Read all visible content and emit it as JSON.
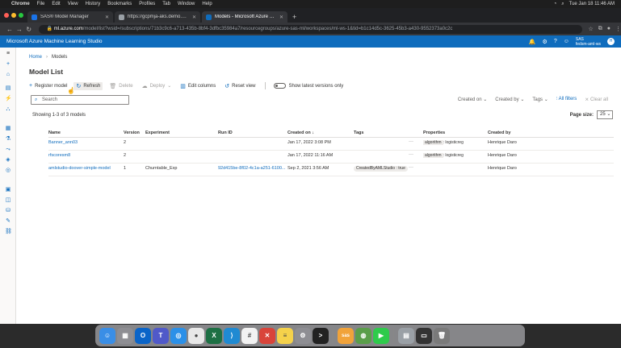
{
  "menubar": {
    "app": "Chrome",
    "items": [
      "File",
      "Edit",
      "View",
      "History",
      "Bookmarks",
      "Profiles",
      "Tab",
      "Window",
      "Help"
    ],
    "clock": "Tue Jan 18 11:46 AM"
  },
  "tabs": [
    {
      "title": "SAS® Model Manager",
      "color": "#1a73e8"
    },
    {
      "title": "https://gcpmja-aks.demo.sas.com",
      "color": "#9aa0a6"
    },
    {
      "title": "Models - Microsoft Azure Machi...",
      "color": "#0f6cbd",
      "active": true
    }
  ],
  "address": {
    "host": "ml.azure.com",
    "path": "/model/list?wsid=/subscriptions/71b3c9c6-a713-435b-8bf4-3dfbc35984a7/resourcegroups/azure-sas-ml/workspaces/ml-ws-1&tid=b1c14d5c-3625-45b3-a430-9552373a0c2c"
  },
  "azure": {
    "product": "Microsoft Azure Machine Learning Studio",
    "workspace_line1": "SAS",
    "workspace_line2": "fedsm-aml-ws",
    "avatar": "H"
  },
  "breadcrumb": {
    "home": "Home",
    "sep": "›",
    "current": "Models"
  },
  "page_title": "Model List",
  "toolbar": {
    "register": "Register model",
    "refresh": "Refresh",
    "delete": "Delete",
    "deploy": "Deploy",
    "edit_columns": "Edit columns",
    "reset_view": "Reset view",
    "show_latest": "Show latest versions only"
  },
  "search": {
    "placeholder": "Search"
  },
  "filters": {
    "created_on": "Created on",
    "created_by": "Created by",
    "tags": "Tags",
    "all_filters": "All filters",
    "clear_all": "Clear all"
  },
  "showing": "Showing 1-3 of 3 models",
  "page_size": {
    "label": "Page size:",
    "value": "25"
  },
  "table": {
    "headers": [
      "Name",
      "Version",
      "Experiment",
      "Run ID",
      "Created on ↓",
      "Tags",
      "Properties",
      "Created by"
    ],
    "rows": [
      {
        "name": "Banner_ann03",
        "version": "2",
        "experiment": "",
        "run_id": "",
        "created": "Jan 17, 2022 3:08 PM",
        "tags": "",
        "props_k": "algorithm",
        "props_v": ": logisticreg",
        "created_by": "Henrique Daro"
      },
      {
        "name": "rfscoresm8",
        "version": "2",
        "experiment": "",
        "run_id": "",
        "created": "Jan 17, 2022 11:16 AM",
        "tags": "",
        "props_k": "algorithm",
        "props_v": ": logisticreg",
        "created_by": "Henrique Daro"
      },
      {
        "name": "amlstudio-doover-simple-model",
        "version": "1",
        "experiment": "Churntable_Exp",
        "run_id": "92d415be-8f02-4c1a-a251-6100...",
        "created": "Sep 2, 2021 3:56 AM",
        "tags": "CreatedByAMLStudio : true",
        "props_k": "",
        "props_v": "",
        "created_by": "Henrique Daro"
      }
    ]
  },
  "dock": [
    {
      "name": "finder",
      "color": "#3a8ee6",
      "glyph": "☺"
    },
    {
      "name": "launchpad",
      "color": "#8e8e93",
      "glyph": "▦"
    },
    {
      "name": "outlook",
      "color": "#0a64c8",
      "glyph": "O"
    },
    {
      "name": "teams",
      "color": "#5059c9",
      "glyph": "T"
    },
    {
      "name": "safari",
      "color": "#2b90e8",
      "glyph": "◎"
    },
    {
      "name": "chrome",
      "color": "#e8e8e8",
      "glyph": "●"
    },
    {
      "name": "excel",
      "color": "#1d7044",
      "glyph": "X"
    },
    {
      "name": "vscode",
      "color": "#1f8ad2",
      "glyph": "⟩"
    },
    {
      "name": "slack",
      "color": "#f2f2f2",
      "glyph": "#"
    },
    {
      "name": "sas",
      "color": "#d9443a",
      "glyph": "✕"
    },
    {
      "name": "notes",
      "color": "#f5d24b",
      "glyph": "≡"
    },
    {
      "name": "settings",
      "color": "#8e8e93",
      "glyph": "⚙"
    },
    {
      "name": "terminal",
      "color": "#222",
      "glyph": ">"
    },
    {
      "name": "sas-launcher",
      "color": "#f1a33a",
      "glyph": "sas"
    },
    {
      "name": "globe",
      "color": "#5a9e4a",
      "glyph": "◍"
    },
    {
      "name": "facetime",
      "color": "#2ecb4b",
      "glyph": "▶"
    },
    {
      "name": "preview",
      "color": "#9aa0a6",
      "glyph": "▤"
    },
    {
      "name": "display",
      "color": "#333",
      "glyph": "▭"
    },
    {
      "name": "trash",
      "color": "#7a7a7a",
      "glyph": "🗑"
    }
  ]
}
